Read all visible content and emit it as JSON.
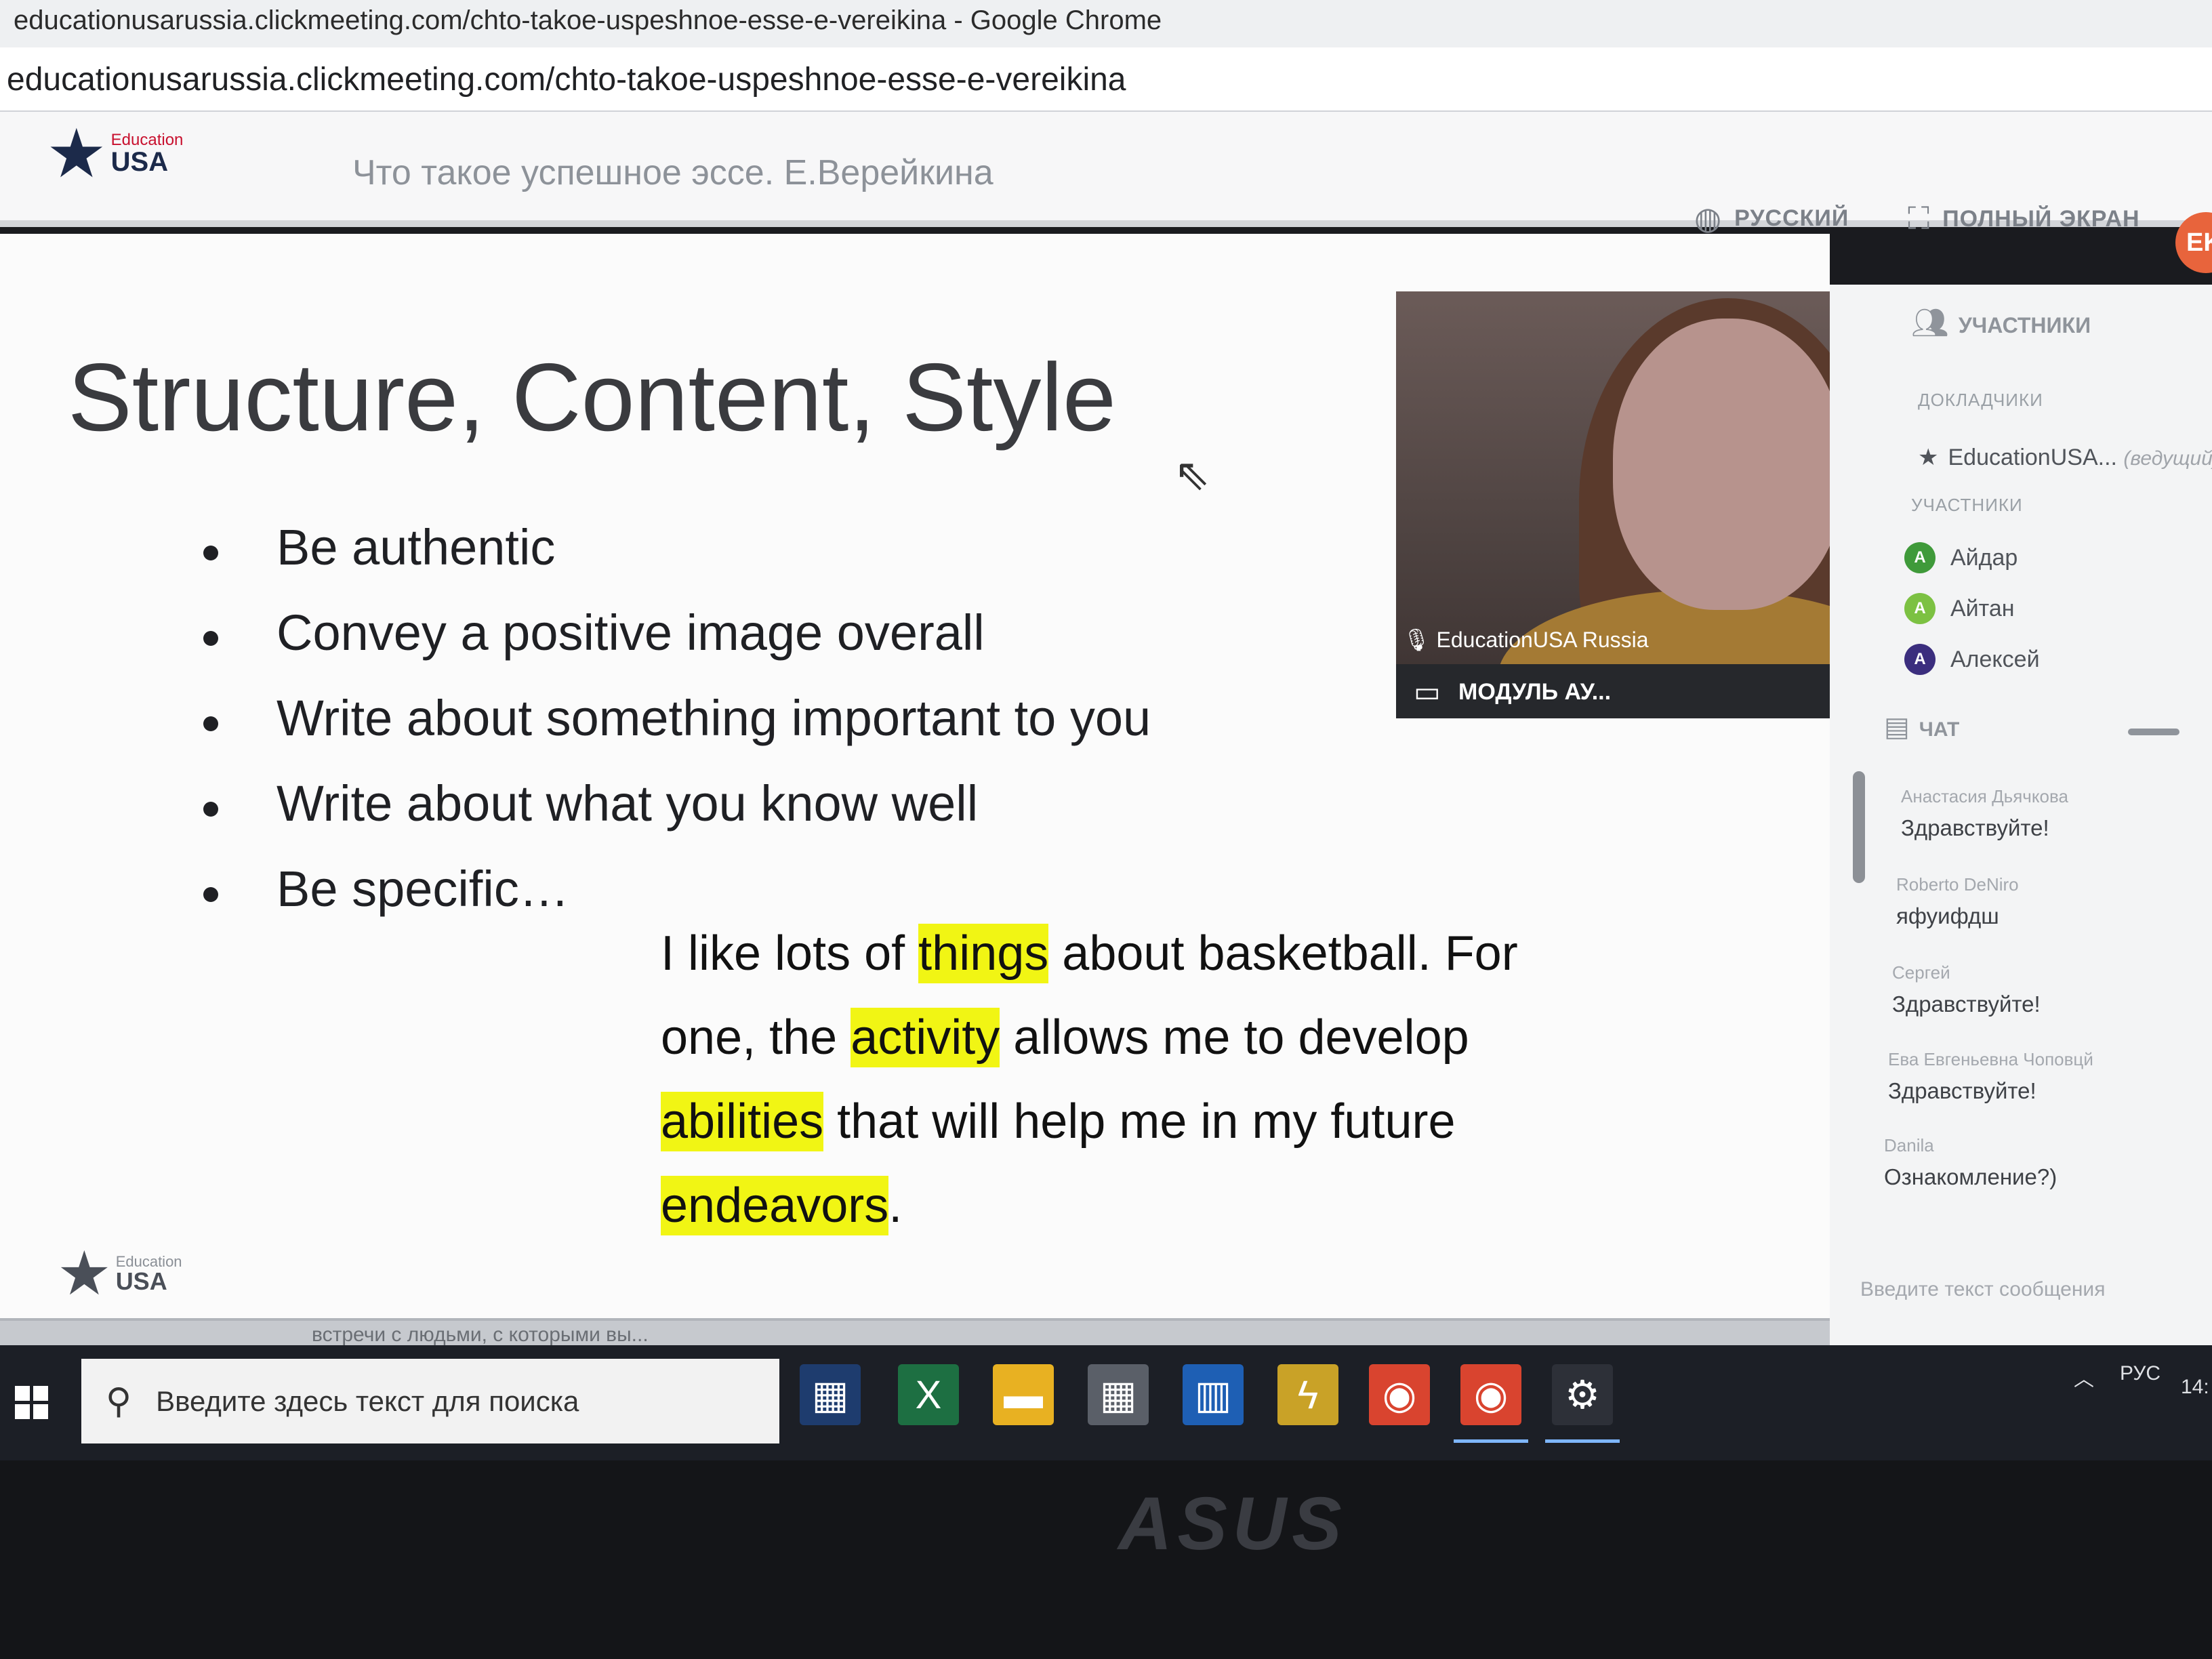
{
  "browser": {
    "window_title": "educationusarussia.clickmeeting.com/chto-takoe-uspeshnoe-esse-e-vereikina - Google Chrome",
    "address": "educationusarussia.clickmeeting.com/chto-takoe-uspeshnoe-esse-e-vereikina"
  },
  "header": {
    "logo_small": "Education",
    "logo_big": "USA",
    "webinar_title": "Что такое успешное эссе. Е.Верейкина",
    "language_label": "РУССКИЙ",
    "fullscreen_label": "ПОЛНЫЙ ЭКРАН",
    "avatar_initials": "EK"
  },
  "slide": {
    "title": "Structure, Content, Style",
    "bullets": [
      "Be authentic",
      "Convey a positive image overall",
      "Write about something important to you",
      "Write about what you know well",
      "Be specific…"
    ],
    "quote_parts": [
      "I like lots of ",
      "things",
      " about basketball. For one, the ",
      "activity",
      " allows me to develop ",
      "abilities",
      " that will help me in my future ",
      "endeavors",
      "."
    ],
    "footer_logo_small": "Education",
    "footer_logo_big": "USA",
    "next_slide_peek": "встречи с людьми, с которыми вы..."
  },
  "video": {
    "speaker_name": "EducationUSA Russia",
    "module_label": "МОДУЛЬ АУ..."
  },
  "sidebar": {
    "participants_title": "УЧАСТНИКИ",
    "presenters_label": "ДОКЛАДЧИКИ",
    "presenter_name": "EducationUSA...",
    "presenter_role": "(ведущий)",
    "attendees_label": "УЧАСТНИКИ",
    "attendees": [
      {
        "initial": "A",
        "name": "Айдар",
        "color": "#3f9a3a"
      },
      {
        "initial": "A",
        "name": "Айтан",
        "color": "#7cc142"
      },
      {
        "initial": "A",
        "name": "Алексей",
        "color": "#3b2e7e"
      }
    ],
    "chat_title": "ЧАТ",
    "chat_messages": [
      {
        "author": "Анастасия Дьячкова",
        "text": "Здравствуйте!"
      },
      {
        "author": "Roberto DeNiro",
        "text": "яфуифдш"
      },
      {
        "author": "Сергей",
        "text": "Здравствуйте!"
      },
      {
        "author": "Ева Евгеньевна Чоповцй",
        "text": "Здравствуйте!"
      },
      {
        "author": "Danila",
        "text": "Ознакомление?)"
      }
    ],
    "chat_placeholder": "Введите текст сообщения"
  },
  "taskbar": {
    "search_placeholder": "Введите здесь текст для поиска",
    "language": "РУС",
    "clock": "14:"
  },
  "bezel": {
    "brand": "ASUS"
  },
  "colors": {
    "highlight": "#f1f514",
    "brand_navy": "#1c2a4a",
    "brand_red": "#c8102e",
    "avatar_orange": "#e8643c"
  }
}
